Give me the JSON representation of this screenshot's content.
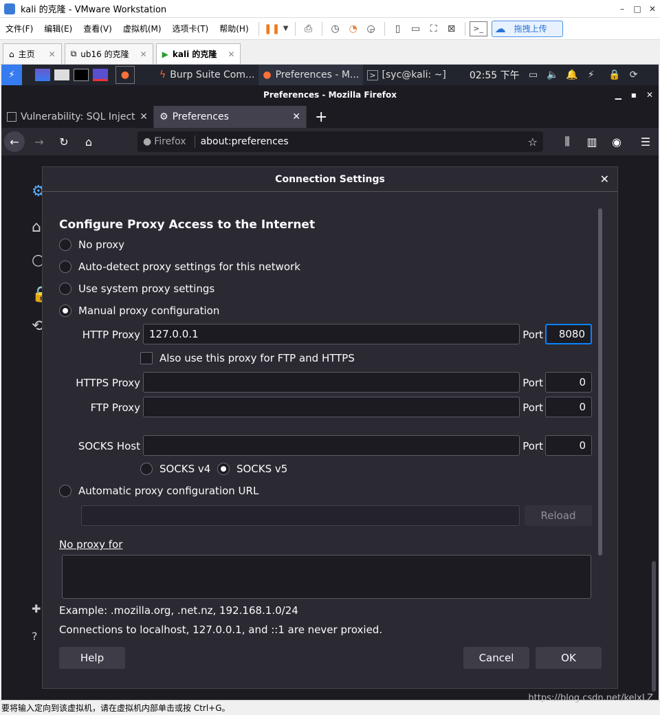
{
  "vm": {
    "title": "kali 的克隆 - VMware Workstation",
    "menus": [
      "文件(F)",
      "编辑(E)",
      "查看(V)",
      "虚拟机(M)",
      "选项卡(T)",
      "帮助(H)"
    ],
    "upload_label": "拖拽上传",
    "tabs": [
      {
        "label": "主页",
        "active": false
      },
      {
        "label": "ub16 的克隆",
        "active": false
      },
      {
        "label": "kali 的克隆",
        "active": true
      }
    ],
    "status_text": "要将输入定向到该虚拟机，请在虚拟机内部单击或按 Ctrl+G。"
  },
  "kali_panel": {
    "tasks": [
      {
        "label": "Burp Suite Com...",
        "active": false
      },
      {
        "label": "Preferences - M...",
        "active": true
      },
      {
        "label": "[syc@kali: ~]",
        "active": false
      }
    ],
    "clock": "02:55 下午"
  },
  "firefox": {
    "window_title": "Preferences - Mozilla Firefox",
    "tabs": [
      {
        "label": "Vulnerability: SQL Injecti",
        "active": false
      },
      {
        "label": "Preferences",
        "active": true
      }
    ],
    "identity": "Firefox",
    "url": "about:preferences"
  },
  "dialog": {
    "title": "Connection Settings",
    "heading": "Configure Proxy Access to the Internet",
    "options": {
      "no_proxy": "No proxy",
      "auto_detect": "Auto-detect proxy settings for this network",
      "system": "Use system proxy settings",
      "manual": "Manual proxy configuration",
      "auto_url": "Automatic proxy configuration URL"
    },
    "selected": "manual",
    "http_proxy_label": "HTTP Proxy",
    "http_proxy_value": "127.0.0.1",
    "http_port": "8080",
    "port_label": "Port",
    "also_use_label": "Also use this proxy for FTP and HTTPS",
    "https_proxy_label": "HTTPS Proxy",
    "https_port": "0",
    "ftp_proxy_label": "FTP Proxy",
    "ftp_port": "0",
    "socks_host_label": "SOCKS Host",
    "socks_port": "0",
    "socks_v4": "SOCKS v4",
    "socks_v5": "SOCKS v5",
    "socks_selected": "v5",
    "reload_label": "Reload",
    "no_proxy_for_label": "No proxy for",
    "example_text": "Example: .mozilla.org, .net.nz, 192.168.1.0/24",
    "localhost_note": "Connections to localhost, 127.0.0.1, and ::1 are never proxied.",
    "help_label": "Help",
    "cancel_label": "Cancel",
    "ok_label": "OK"
  },
  "watermark": "https://blog.csdn.net/kelxLZ"
}
